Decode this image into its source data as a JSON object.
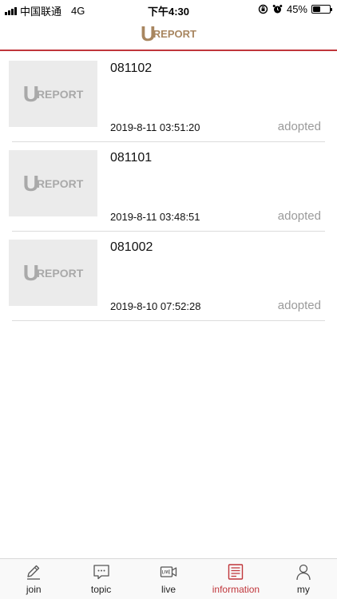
{
  "status_bar": {
    "carrier": "中国联通",
    "network": "4G",
    "time": "下午4:30",
    "battery_text": "45%",
    "battery_level": 0.45
  },
  "header": {
    "logo_u": "U",
    "logo_text": "REPORT"
  },
  "list": {
    "items": [
      {
        "title": "081102",
        "date": "2019-8-11 03:51:20",
        "status": "adopted",
        "thumb_u": "U",
        "thumb_text": "REPORT"
      },
      {
        "title": "081101",
        "date": "2019-8-11 03:48:51",
        "status": "adopted",
        "thumb_u": "U",
        "thumb_text": "REPORT"
      },
      {
        "title": "081002",
        "date": "2019-8-10 07:52:28",
        "status": "adopted",
        "thumb_u": "U",
        "thumb_text": "REPORT"
      }
    ]
  },
  "tab_bar": {
    "tabs": [
      {
        "label": "join",
        "icon": "pencil-icon"
      },
      {
        "label": "topic",
        "icon": "chat-bubble-icon"
      },
      {
        "label": "live",
        "icon": "live-camera-icon"
      },
      {
        "label": "information",
        "icon": "newspaper-icon",
        "active": true
      },
      {
        "label": "my",
        "icon": "person-icon"
      }
    ],
    "active_color": "#c0363b"
  },
  "colors": {
    "accent": "#c0363b",
    "logo": "#a88660",
    "status_gray": "#9a9a9a"
  }
}
